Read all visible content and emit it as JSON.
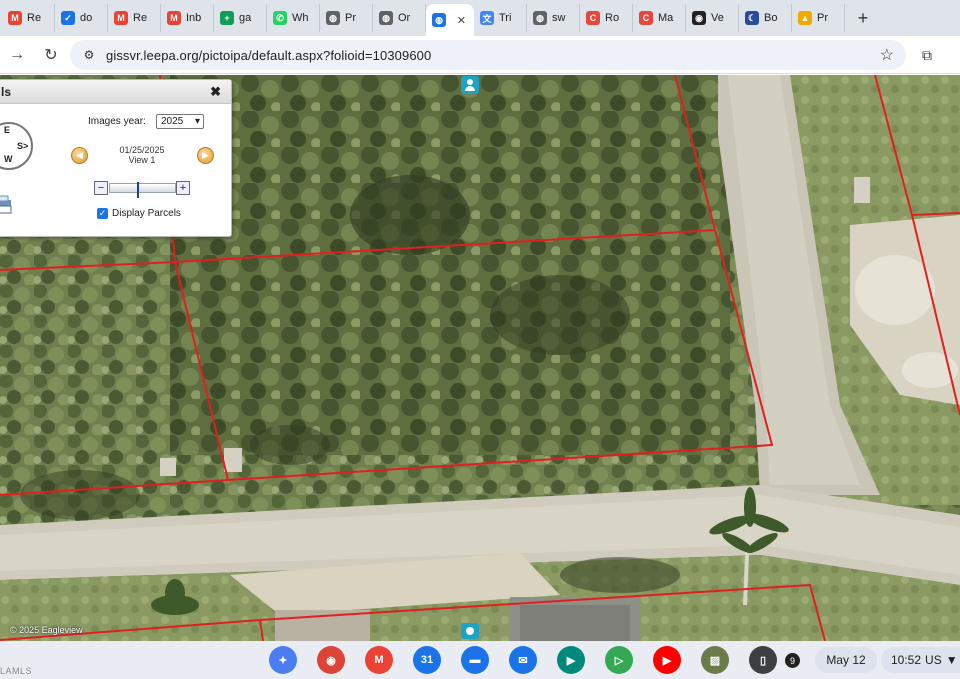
{
  "browser": {
    "tabs": [
      {
        "title": "Re",
        "icon": "gmail-icon",
        "color": "#ea4335",
        "glyph": "M"
      },
      {
        "title": "do",
        "icon": "docs-check-icon",
        "color": "#1a73e8",
        "glyph": "✓"
      },
      {
        "title": "Re",
        "icon": "gmail-icon",
        "color": "#ea4335",
        "glyph": "M"
      },
      {
        "title": "Inb",
        "icon": "gmail-icon",
        "color": "#ea4335",
        "glyph": "M"
      },
      {
        "title": "ga",
        "icon": "sheets-icon",
        "color": "#0f9d58",
        "glyph": "+"
      },
      {
        "title": "Wh",
        "icon": "whatsapp-icon",
        "color": "#25d366",
        "glyph": "✆"
      },
      {
        "title": "Pr",
        "icon": "globe-icon",
        "color": "#5f6368",
        "glyph": "◍"
      },
      {
        "title": "Or",
        "icon": "globe-icon",
        "color": "#5f6368",
        "glyph": "◍"
      },
      {
        "title": "",
        "icon": "globe-icon",
        "color": "#1a73e8",
        "glyph": "◍",
        "active": true
      },
      {
        "title": "Tri",
        "icon": "translate-icon",
        "color": "#4285f4",
        "glyph": "文"
      },
      {
        "title": "sw",
        "icon": "globe-icon",
        "color": "#5f6368",
        "glyph": "◍"
      },
      {
        "title": "Ro",
        "icon": "c-logo-icon",
        "color": "#e8453c",
        "glyph": "C"
      },
      {
        "title": "Ma",
        "icon": "c-logo-icon",
        "color": "#e8453c",
        "glyph": "C"
      },
      {
        "title": "Ve",
        "icon": "spiral-icon",
        "color": "#222222",
        "glyph": "◉"
      },
      {
        "title": "Bo",
        "icon": "moon-icon",
        "color": "#2a4b9b",
        "glyph": "☾"
      },
      {
        "title": "Pr",
        "icon": "cone-icon",
        "color": "#f2a900",
        "glyph": "▲"
      }
    ],
    "url": "gissvr.leepa.org/pictoipa/default.aspx?folioid=10309600"
  },
  "panel": {
    "title": "ls",
    "close": "✖",
    "compass": {
      "e": "E",
      "s": "S",
      "w": "W",
      "sx": "S>",
      "i": "I"
    },
    "images_year_label": "Images year:",
    "images_year_value": "2025",
    "date": "01/25/2025",
    "view": "View 1",
    "zoom_minus": "−",
    "zoom_plus": "+",
    "zoom_level": 0.42,
    "display_parcels_label": "Display Parcels",
    "display_parcels_checked": true
  },
  "map": {
    "copyright": "© 2025 Eagleview",
    "parcel_line_color": "#e02020"
  },
  "shelf": {
    "watermark": "LAMLS",
    "apps": [
      {
        "name": "gemini-app-icon",
        "color": "#4a7ef0",
        "glyph": "✦"
      },
      {
        "name": "chrome-app-icon",
        "color": "#db4437",
        "glyph": "◉"
      },
      {
        "name": "gmail-app-icon",
        "color": "#ea4335",
        "glyph": "M"
      },
      {
        "name": "calendar-app-icon",
        "color": "#1a73e8",
        "glyph": "31"
      },
      {
        "name": "files-app-icon",
        "color": "#1a73e8",
        "glyph": "▬"
      },
      {
        "name": "messages-app-icon",
        "color": "#1a73e8",
        "glyph": "✉"
      },
      {
        "name": "meet-app-icon",
        "color": "#00897b",
        "glyph": "▶"
      },
      {
        "name": "play-store-app-icon",
        "color": "#34a853",
        "glyph": "▷"
      },
      {
        "name": "youtube-app-icon",
        "color": "#ff0000",
        "glyph": "▶"
      },
      {
        "name": "photo-app-icon",
        "color": "#6b7b4a",
        "glyph": "▨"
      },
      {
        "name": "phone-hub-icon",
        "color": "#3c4043",
        "glyph": "▯"
      }
    ],
    "notifications": "9",
    "date": "May 12",
    "time": "10:52",
    "locale": "US"
  }
}
